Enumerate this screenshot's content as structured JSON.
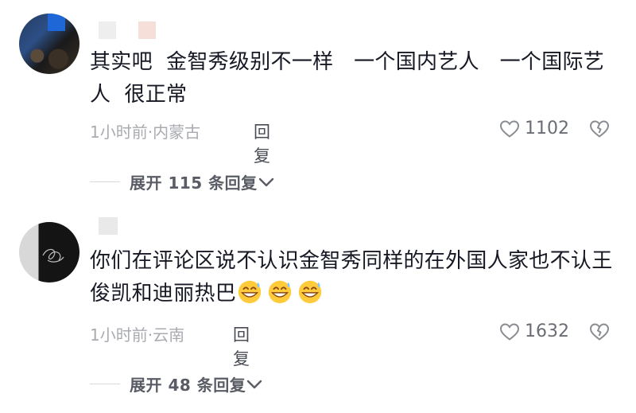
{
  "comments": [
    {
      "text": "其实吧  金智秀级别不一样   一个国内艺人   一个国际艺人  很正常",
      "meta": "1小时前·内蒙古",
      "reply_label": "回复",
      "likes": "1102",
      "expand_label": "展开 115 条回复"
    },
    {
      "text": "你们在评论区说不认识金智秀同样的在外国人家也不认王俊凯和迪丽热巴",
      "meta": "1小时前·云南",
      "reply_label": "回复",
      "likes": "1632",
      "expand_label": "展开 48 条回复",
      "emoji_icon": "grinning-sweat-emoji"
    }
  ],
  "icons": {
    "like": "heart-outline-icon",
    "dislike": "broken-heart-icon",
    "expand": "chevron-down-icon"
  },
  "colors": {
    "text": "#161823",
    "meta": "#a9abb1",
    "reply": "#4a4c55"
  }
}
